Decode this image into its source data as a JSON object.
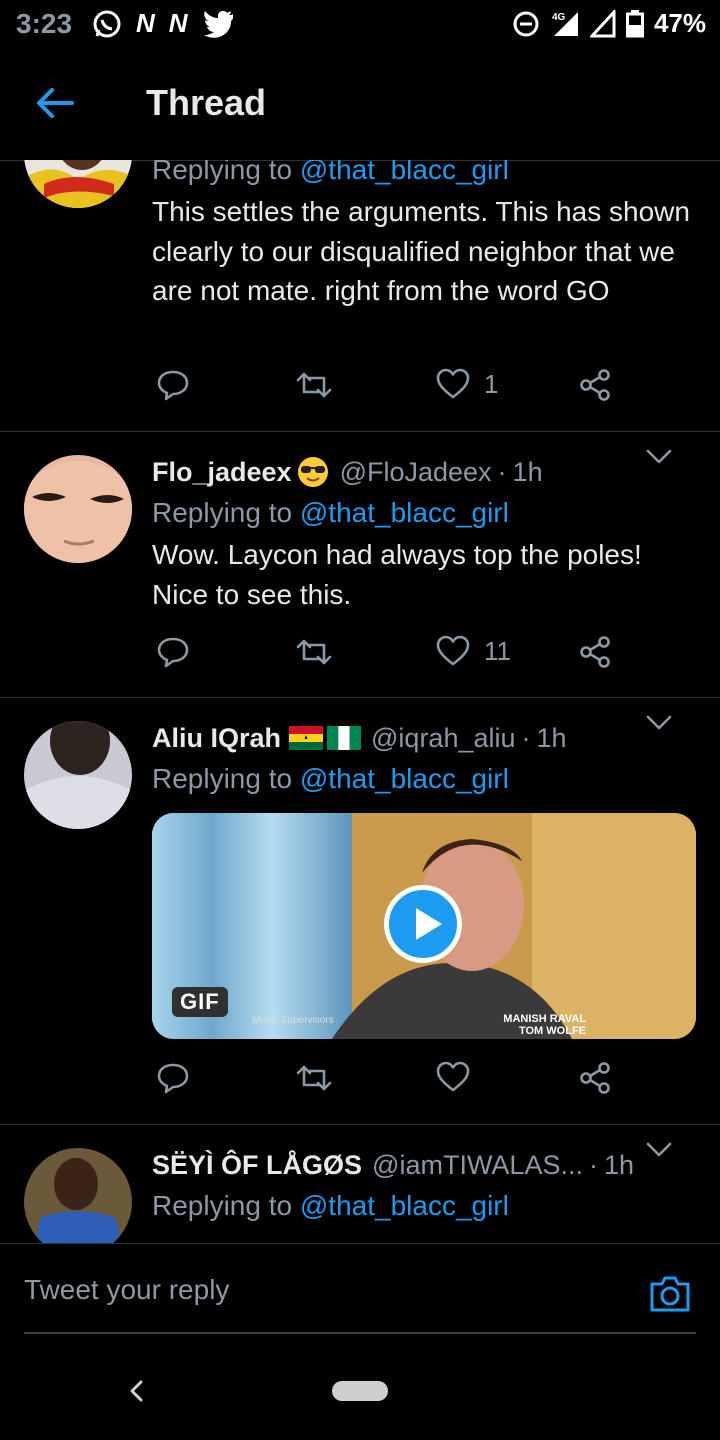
{
  "status_bar": {
    "time": "3:23",
    "app_icons": [
      "whatsapp-icon",
      "N",
      "N",
      "twitter-icon"
    ],
    "network": "4G",
    "battery": "47%"
  },
  "header": {
    "title": "Thread"
  },
  "tweets": [
    {
      "name": "",
      "handle": "",
      "time": "",
      "replying_prefix": "Replying to ",
      "replying_to": "@that_blacc_girl",
      "text": "This settles the arguments. This has shown clearly to our disqualified neighbor that we are not mate. right from the word GO",
      "likes": "1"
    },
    {
      "name": "Flo_jadeex",
      "name_emoji": "sunglasses-emoji",
      "handle": "@FloJadeex",
      "separator": "·",
      "time": "1h",
      "replying_prefix": "Replying to ",
      "replying_to": "@that_blacc_girl",
      "text": "Wow. Laycon had always top the poles! Nice to see this.",
      "likes": "11"
    },
    {
      "name": "Aliu IQrah",
      "name_emoji": "ghana-nigeria-flags",
      "handle": "@iqrah_aliu",
      "separator": "·",
      "time": "1h",
      "replying_prefix": "Replying to ",
      "replying_to": "@that_blacc_girl",
      "gif": {
        "badge": "GIF",
        "credit_left": "Music Supervisors",
        "credit_right_1": "MANISH RAVAL",
        "credit_right_2": "TOM WOLFE"
      },
      "likes": ""
    },
    {
      "name": "SËYÌ ÔF LÅGØS",
      "handle": "@iamTIWALAS...",
      "separator": "·",
      "time": "1h",
      "replying_prefix": "Replying to ",
      "replying_to": "@that_blacc_girl"
    }
  ],
  "reply_bar": {
    "placeholder": "Tweet your reply"
  },
  "colors": {
    "accent": "#1d9bf0",
    "background": "#000000",
    "muted": "#8b98a5"
  }
}
